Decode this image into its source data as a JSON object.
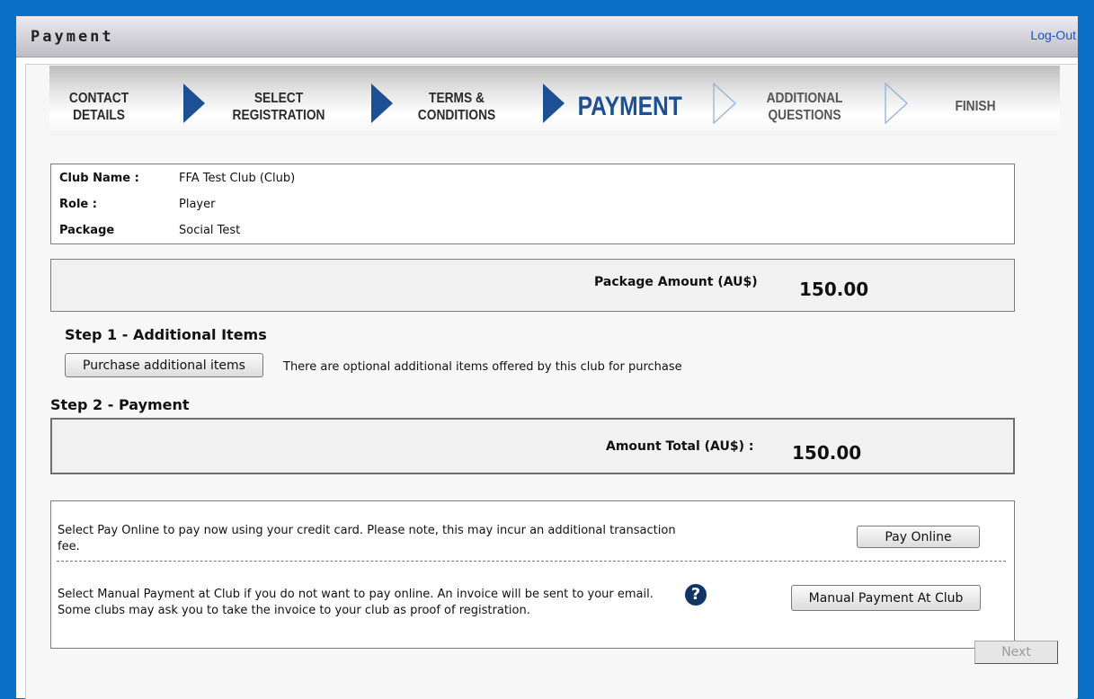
{
  "page": {
    "title": "Payment",
    "logout_label": "Log-Out"
  },
  "steps": [
    {
      "line1": "Contact",
      "line2": "Details",
      "state": "done"
    },
    {
      "line1": "Select",
      "line2": "Registration",
      "state": "done"
    },
    {
      "line1": "Terms &",
      "line2": "Conditions",
      "state": "done"
    },
    {
      "line1": "Payment",
      "line2": "",
      "state": "active"
    },
    {
      "line1": "Additional",
      "line2": "Questions",
      "state": "pending"
    },
    {
      "line1": "Finish",
      "line2": "",
      "state": "pending"
    }
  ],
  "colors": {
    "frame": "#0a6fc7",
    "step_arrow_filled": "#1c4f94",
    "step_arrow_outline": "#8fb3dd"
  },
  "registration": {
    "club_name_label": "Club Name :",
    "club_name_value": "FFA Test Club (Club)",
    "role_label": "Role :",
    "role_value": "Player",
    "package_label": "Package",
    "package_value": "Social Test"
  },
  "package_amount": {
    "label": "Package Amount (AU$)",
    "value": "150.00"
  },
  "step1": {
    "heading": "Step 1 - Additional Items",
    "button_label": "Purchase additional items",
    "note": "There are optional additional items offered by this club for purchase"
  },
  "step2": {
    "heading": "Step 2 - Payment"
  },
  "amount_total": {
    "label": "Amount Total (AU$) :",
    "value": "150.00"
  },
  "payment_options": {
    "online_text": "Select Pay Online to pay now using your credit card. Please note, this may incur an additional transaction fee.",
    "online_button": "Pay Online",
    "manual_text": "Select Manual Payment at Club if you do not want to pay online. An invoice will be sent to your email. Some clubs may ask you to take the invoice to your club as proof of registration.",
    "help_icon": "question-circle-icon",
    "help_glyph": "?",
    "manual_button": "Manual Payment At Club"
  },
  "footer": {
    "next_label": "Next"
  }
}
